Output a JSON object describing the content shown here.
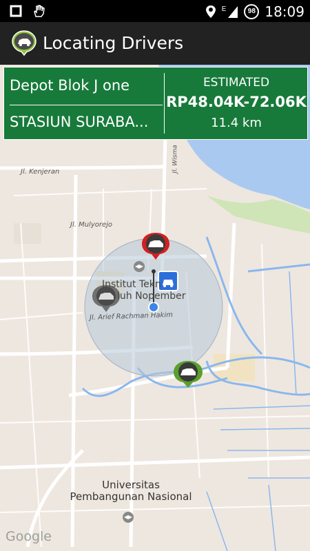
{
  "status_bar": {
    "time": "18:09",
    "battery_level": "98",
    "network_type": "E",
    "icons": [
      "square-icon",
      "hand-icon",
      "location-pin-icon",
      "signal-icon",
      "battery-icon"
    ]
  },
  "app_bar": {
    "title": "Locating Drivers",
    "logo_icon": "taxi-bubble-logo"
  },
  "info_panel": {
    "origin": "Depot Blok J one",
    "destination": "STASIUN SURABA...",
    "estimated_label": "ESTIMATED",
    "price_range": "RP48.04K-72.06K",
    "distance": "11.4 km"
  },
  "map": {
    "street_labels": [
      "Jl. Kenjeran",
      "Jl. Mulyorejo",
      "Jl. Arief Rachman Hakim",
      "Jl. Wisma"
    ],
    "poi_labels": {
      "its_line1": "Institut Tekn",
      "its_line2": "luh Nopember",
      "upn_line1": "Universitas",
      "upn_line2": "Pembangunan Nasional"
    },
    "attribution": "Google",
    "markers": [
      {
        "name": "driver-marker-red",
        "color": "#d32020"
      },
      {
        "name": "driver-marker-gray",
        "color": "#707070"
      },
      {
        "name": "driver-marker-green",
        "color": "#5aa02c"
      }
    ]
  },
  "colors": {
    "panel_green": "#177a3a",
    "app_bar": "#222222",
    "water": "#a9c9f0"
  }
}
